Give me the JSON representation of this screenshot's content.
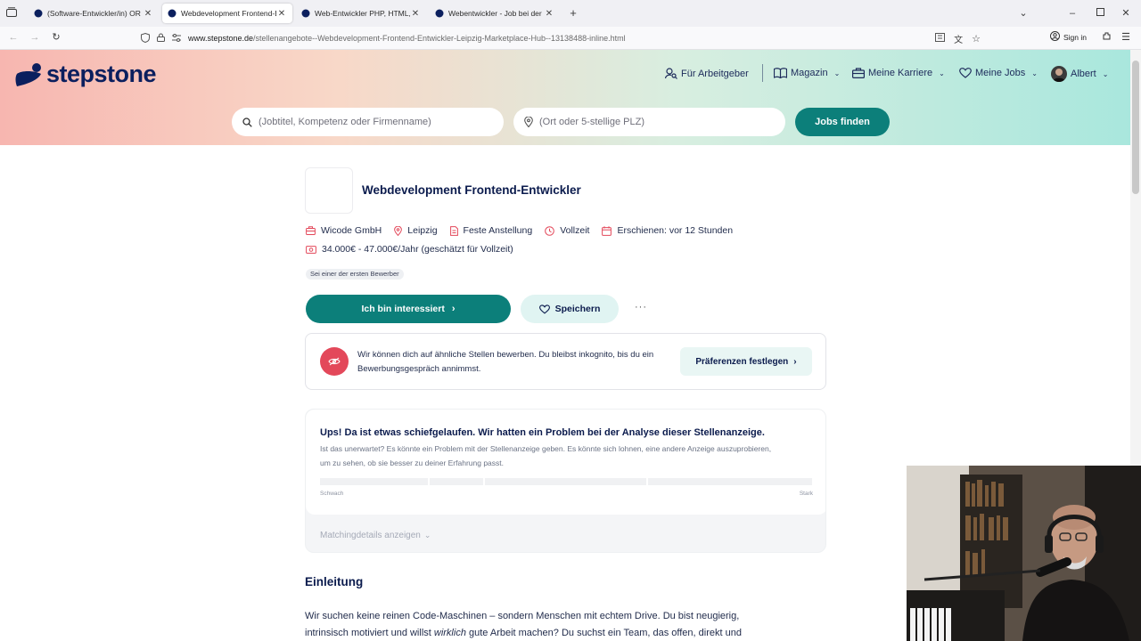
{
  "browser": {
    "tabs": [
      {
        "title": "(Software-Entwickler/in) OR (We",
        "active": false
      },
      {
        "title": "Webdevelopment Frontend-Entw",
        "active": true
      },
      {
        "title": "Web-Entwickler PHP, HTML, Jav",
        "active": false
      },
      {
        "title": "Webentwickler - Job bei der Fir",
        "active": false
      }
    ],
    "url_domain": "www.stepstone.de",
    "url_path": "/stellenangebote--Webdevelopment-Frontend-Entwickler-Leipzig-Marketplace-Hub--13138488-inline.html",
    "sign_in": "Sign in"
  },
  "header": {
    "brand": "stepstone",
    "nav": {
      "employers": "Für Arbeitgeber",
      "magazine": "Magazin",
      "career": "Meine Karriere",
      "jobs": "Meine Jobs",
      "user": "Albert"
    },
    "search": {
      "what_placeholder": "(Jobtitel, Kompetenz oder Firmenname)",
      "where_placeholder": "(Ort oder 5-stellige PLZ)",
      "button": "Jobs finden"
    }
  },
  "job": {
    "title": "Webdevelopment Frontend-Entwickler",
    "company": "Wicode GmbH",
    "location": "Leipzig",
    "contract": "Feste Anstellung",
    "hours": "Vollzeit",
    "published": "Erschienen: vor 12 Stunden",
    "salary": "34.000€ - 47.000€/Jahr (geschätzt für Vollzeit)",
    "early_badge": "Sei einer der ersten Bewerber",
    "apply": "Ich bin interessiert",
    "save": "Speichern",
    "more": "···"
  },
  "incognito": {
    "text": "Wir können dich auf ähnliche Stellen bewerben. Du bleibst inkognito, bis du ein Bewerbungsgespräch annimmst.",
    "button": "Präferenzen festlegen"
  },
  "matching": {
    "error_title": "Ups! Da ist etwas schiefgelaufen. Wir hatten ein Problem bei der Analyse dieser Stellenanzeige.",
    "error_body": "Ist das unerwartet? Es könnte ein Problem mit der Stellenanzeige geben. Es könnte sich lohnen, eine andere Anzeige auszuprobieren, um zu sehen, ob sie besser zu deiner Erfahrung passt.",
    "weak": "Schwach",
    "strong": "Stark",
    "details": "Matchingdetails anzeigen"
  },
  "intro": {
    "heading": "Einleitung",
    "p1": "Wir suchen keine reinen Code-Maschinen – sondern Menschen mit echtem Drive. Du bist neugierig,",
    "p2a": "intrinsisch motiviert und willst ",
    "p2em": "wirklich",
    "p2b": " gute Arbeit machen? Du suchst ein Team, das offen, direkt und"
  },
  "colors": {
    "primary": "#0c7f7a",
    "navy": "#0b1b4d",
    "accent_red": "#e3485a"
  }
}
